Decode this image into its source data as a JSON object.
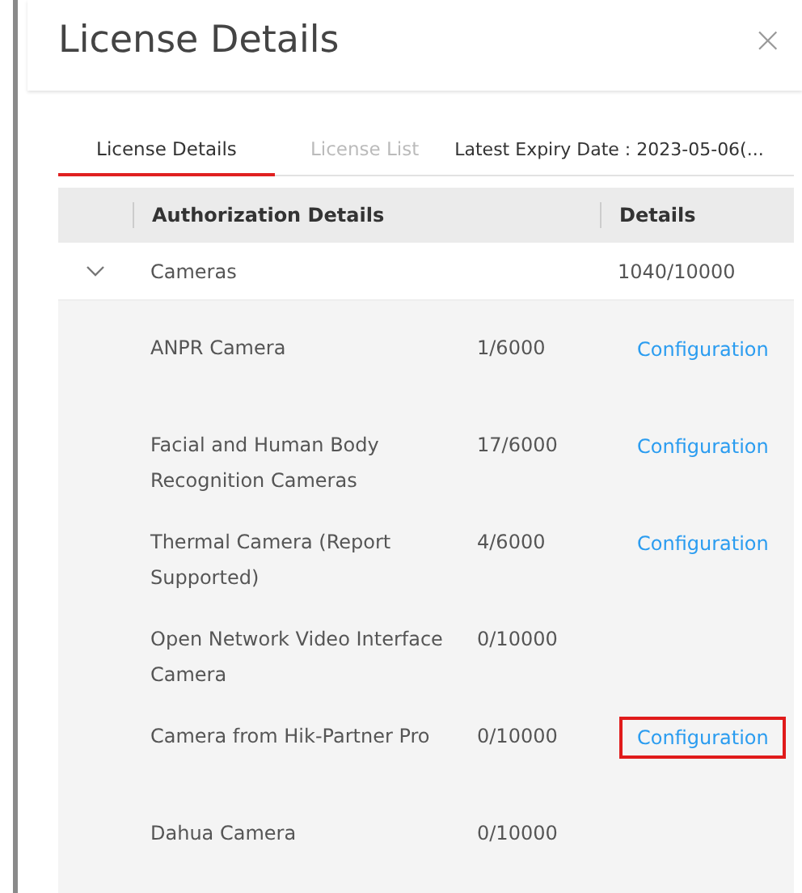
{
  "dialog": {
    "title": "License Details",
    "close": "×"
  },
  "tabs": [
    {
      "label": "License Details",
      "selected": true
    },
    {
      "label": "License List",
      "selected": false
    }
  ],
  "expiry": "Latest Expiry Date : 2023-05-06(...",
  "table": {
    "columns": [
      "Authorization Details",
      "Details"
    ],
    "group": {
      "name": "Cameras",
      "count": "1040/10000",
      "expanded": true,
      "children": [
        {
          "name": "ANPR Camera",
          "count": "1/6000",
          "link": "Configuration",
          "highlighted": false
        },
        {
          "name": "Facial and Human Body Recognition Cameras",
          "count": "17/6000",
          "link": "Configuration",
          "highlighted": false
        },
        {
          "name": "Thermal Camera (Report Supported)",
          "count": "4/6000",
          "link": "Configuration",
          "highlighted": false
        },
        {
          "name": "Open Network Video Interface Camera",
          "count": "0/10000"
        },
        {
          "name": "Camera from Hik-Partner Pro",
          "count": "0/10000",
          "link": "Configuration",
          "highlighted": true
        },
        {
          "name": "Dahua Camera",
          "count": "0/10000"
        }
      ]
    }
  }
}
